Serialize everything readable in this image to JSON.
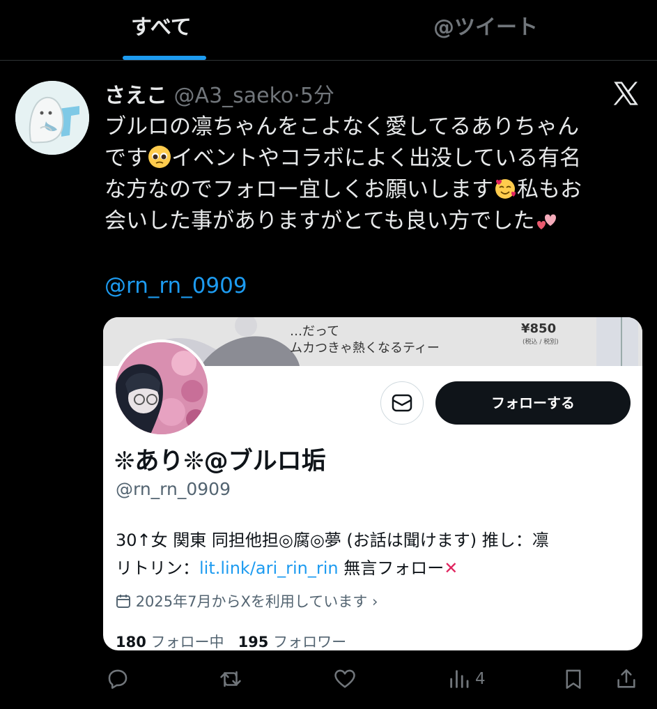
{
  "tabs": {
    "all": "すべて",
    "tweets": "@ツイート"
  },
  "tweet": {
    "display_name": "さえこ",
    "handle": "@A3_saeko",
    "separator": "·",
    "time": "5分",
    "lines": [
      "ブルロの凛ちゃんをこよなく愛してるありちゃん",
      "です",
      "イベントやコラボによく出没している有名",
      "な方なのでフォロー宜しくお願いします",
      "私もお",
      "会いした事がありますがとても良い方でした"
    ],
    "mention": "@rn_rn_0909",
    "emojis": [
      "pleading-face",
      "smiling-face-with-hearts",
      "two-hearts"
    ]
  },
  "card": {
    "banner_text1": "…だって",
    "banner_text2": "ムカつきゃ熱くなるティー",
    "banner_price": "¥850",
    "banner_price_sub": "(税込 / 税別)",
    "follow_label": "フォローする",
    "name": "❊あり❊@ブルロ垢",
    "handle": "@rn_rn_0909",
    "bio_line1": "30↑女 関東 同担他担◎腐◎夢 (お話は聞けます) 推し：凛",
    "bio_line2_prefix": "リトリン：",
    "bio_link": "lit.link/ari_rin_rin",
    "bio_line2_suffix": " 無言フォロー",
    "bio_cross": "✕",
    "joined": "2025年7月からXを利用しています",
    "joined_chevron": "›",
    "following_count": "180",
    "following_label": "フォロー中",
    "followers_count": "195",
    "followers_label": "フォロワー"
  },
  "actions": {
    "views": "4"
  },
  "icons": [
    "reply-icon",
    "retweet-icon",
    "like-icon",
    "views-icon",
    "bookmark-icon",
    "share-icon",
    "x-logo-icon",
    "mail-icon",
    "calendar-icon"
  ],
  "colors": {
    "background": "#000000",
    "accent": "#1d9bf0",
    "muted": "#71767b",
    "text": "#e7e9ea"
  }
}
